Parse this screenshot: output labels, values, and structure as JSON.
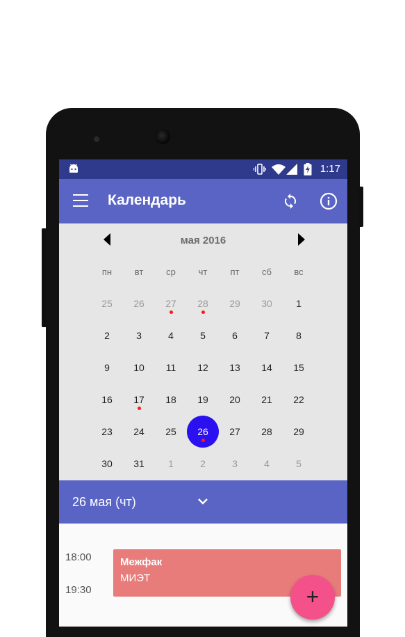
{
  "status_bar": {
    "time": "1:17",
    "icons": [
      "android-icon",
      "vibrate-icon",
      "wifi-icon",
      "signal-icon",
      "battery-charging-icon"
    ]
  },
  "app_bar": {
    "title": "Календарь",
    "icons": [
      "menu-icon",
      "sync-icon",
      "info-icon"
    ],
    "color": "#5a64c4"
  },
  "calendar": {
    "month_label": "мая 2016",
    "weekdays": [
      "пн",
      "вт",
      "ср",
      "чт",
      "пт",
      "сб",
      "вс"
    ],
    "days": [
      {
        "label": "25",
        "muted": true,
        "dot": false
      },
      {
        "label": "26",
        "muted": true,
        "dot": false
      },
      {
        "label": "27",
        "muted": true,
        "dot": true
      },
      {
        "label": "28",
        "muted": true,
        "dot": true
      },
      {
        "label": "29",
        "muted": true,
        "dot": false
      },
      {
        "label": "30",
        "muted": true,
        "dot": false
      },
      {
        "label": "1",
        "muted": false,
        "dot": false
      },
      {
        "label": "2",
        "muted": false,
        "dot": false
      },
      {
        "label": "3",
        "muted": false,
        "dot": false
      },
      {
        "label": "4",
        "muted": false,
        "dot": false
      },
      {
        "label": "5",
        "muted": false,
        "dot": false
      },
      {
        "label": "6",
        "muted": false,
        "dot": false
      },
      {
        "label": "7",
        "muted": false,
        "dot": false
      },
      {
        "label": "8",
        "muted": false,
        "dot": false
      },
      {
        "label": "9",
        "muted": false,
        "dot": false
      },
      {
        "label": "10",
        "muted": false,
        "dot": false
      },
      {
        "label": "11",
        "muted": false,
        "dot": false
      },
      {
        "label": "12",
        "muted": false,
        "dot": false
      },
      {
        "label": "13",
        "muted": false,
        "dot": false
      },
      {
        "label": "14",
        "muted": false,
        "dot": false
      },
      {
        "label": "15",
        "muted": false,
        "dot": false
      },
      {
        "label": "16",
        "muted": false,
        "dot": false
      },
      {
        "label": "17",
        "muted": false,
        "dot": true
      },
      {
        "label": "18",
        "muted": false,
        "dot": false
      },
      {
        "label": "19",
        "muted": false,
        "dot": false
      },
      {
        "label": "20",
        "muted": false,
        "dot": false
      },
      {
        "label": "21",
        "muted": false,
        "dot": false
      },
      {
        "label": "22",
        "muted": false,
        "dot": false
      },
      {
        "label": "23",
        "muted": false,
        "dot": false
      },
      {
        "label": "24",
        "muted": false,
        "dot": false
      },
      {
        "label": "25",
        "muted": false,
        "dot": false
      },
      {
        "label": "26",
        "muted": false,
        "dot": true,
        "selected": true
      },
      {
        "label": "27",
        "muted": false,
        "dot": false
      },
      {
        "label": "28",
        "muted": false,
        "dot": false
      },
      {
        "label": "29",
        "muted": false,
        "dot": false
      },
      {
        "label": "30",
        "muted": false,
        "dot": false
      },
      {
        "label": "31",
        "muted": false,
        "dot": false
      },
      {
        "label": "1",
        "muted": true,
        "dot": false
      },
      {
        "label": "2",
        "muted": true,
        "dot": false
      },
      {
        "label": "3",
        "muted": true,
        "dot": false
      },
      {
        "label": "4",
        "muted": true,
        "dot": false
      },
      {
        "label": "5",
        "muted": true,
        "dot": false
      }
    ],
    "selected_color": "#2b10f0",
    "event_dot_color": "#ff1a1a"
  },
  "selected_date": {
    "label": "26 мая (чт)",
    "icon": "chevron-down-icon"
  },
  "events": {
    "times": [
      "18:00",
      "19:30"
    ],
    "items": [
      {
        "name": "Межфак",
        "place": "МИЭТ",
        "color": "#e77c7b"
      }
    ],
    "fab_label": "+",
    "fab_color": "#f4508a"
  }
}
